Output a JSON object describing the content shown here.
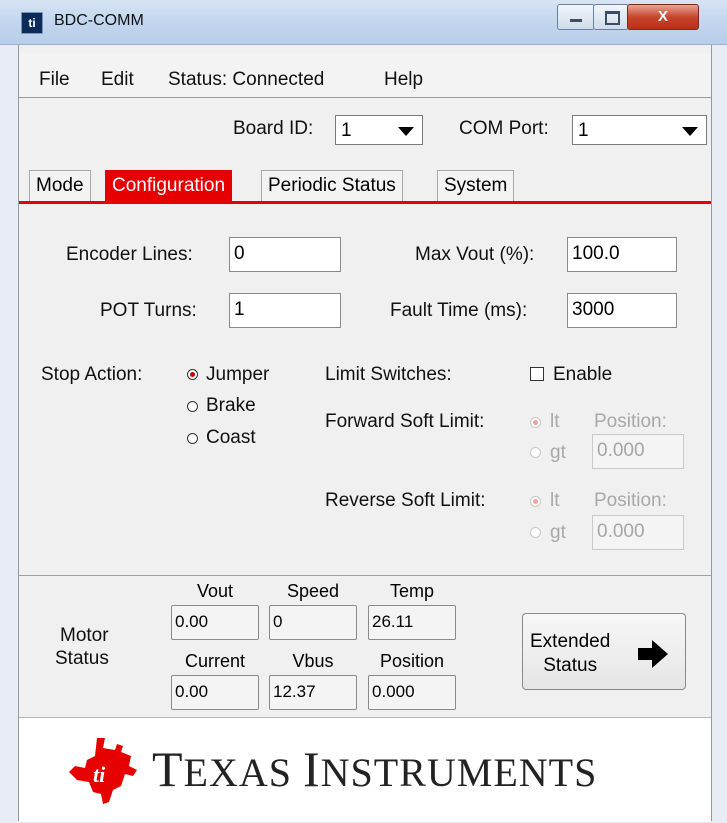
{
  "window": {
    "title": "BDC-COMM",
    "close_glyph": "X"
  },
  "menu": {
    "file": "File",
    "edit": "Edit",
    "status": "Status: Connected",
    "help": "Help"
  },
  "board": {
    "label": "Board ID:",
    "value": "1",
    "com_label": "COM Port:",
    "com_value": "1"
  },
  "tabs": [
    "Mode",
    "Configuration",
    "Periodic Status",
    "System"
  ],
  "config": {
    "encoder_label": "Encoder Lines:",
    "encoder_value": "0",
    "pot_label": "POT Turns:",
    "pot_value": "1",
    "maxvout_label": "Max Vout (%):",
    "maxvout_value": "100.0",
    "fault_label": "Fault Time (ms):",
    "fault_value": "3000",
    "stop_label": "Stop Action:",
    "stop_options": [
      "Jumper",
      "Brake",
      "Coast"
    ],
    "limit_label": "Limit Switches:",
    "enable_label": "Enable",
    "fwd_label": "Forward Soft Limit:",
    "rev_label": "Reverse Soft Limit:",
    "lt_label": "lt",
    "gt_label": "gt",
    "position_label": "Position:",
    "fwd_position": "0.000",
    "rev_position": "0.000"
  },
  "motor_status": {
    "label_line1": "Motor",
    "label_line2": "Status",
    "vout_label": "Vout",
    "vout": "0.00",
    "speed_label": "Speed",
    "speed": "0",
    "temp_label": "Temp",
    "temp": "26.11",
    "current_label": "Current",
    "current": "0.00",
    "vbus_label": "Vbus",
    "vbus": "12.37",
    "position_label": "Position",
    "position": "0.000",
    "extended_line1": "Extended",
    "extended_line2": "Status"
  },
  "logo": {
    "t1": "T",
    "t2": "EXAS ",
    "i1": "I",
    "i2": "NSTRUMENTS",
    "brand_color": "#e60000"
  }
}
